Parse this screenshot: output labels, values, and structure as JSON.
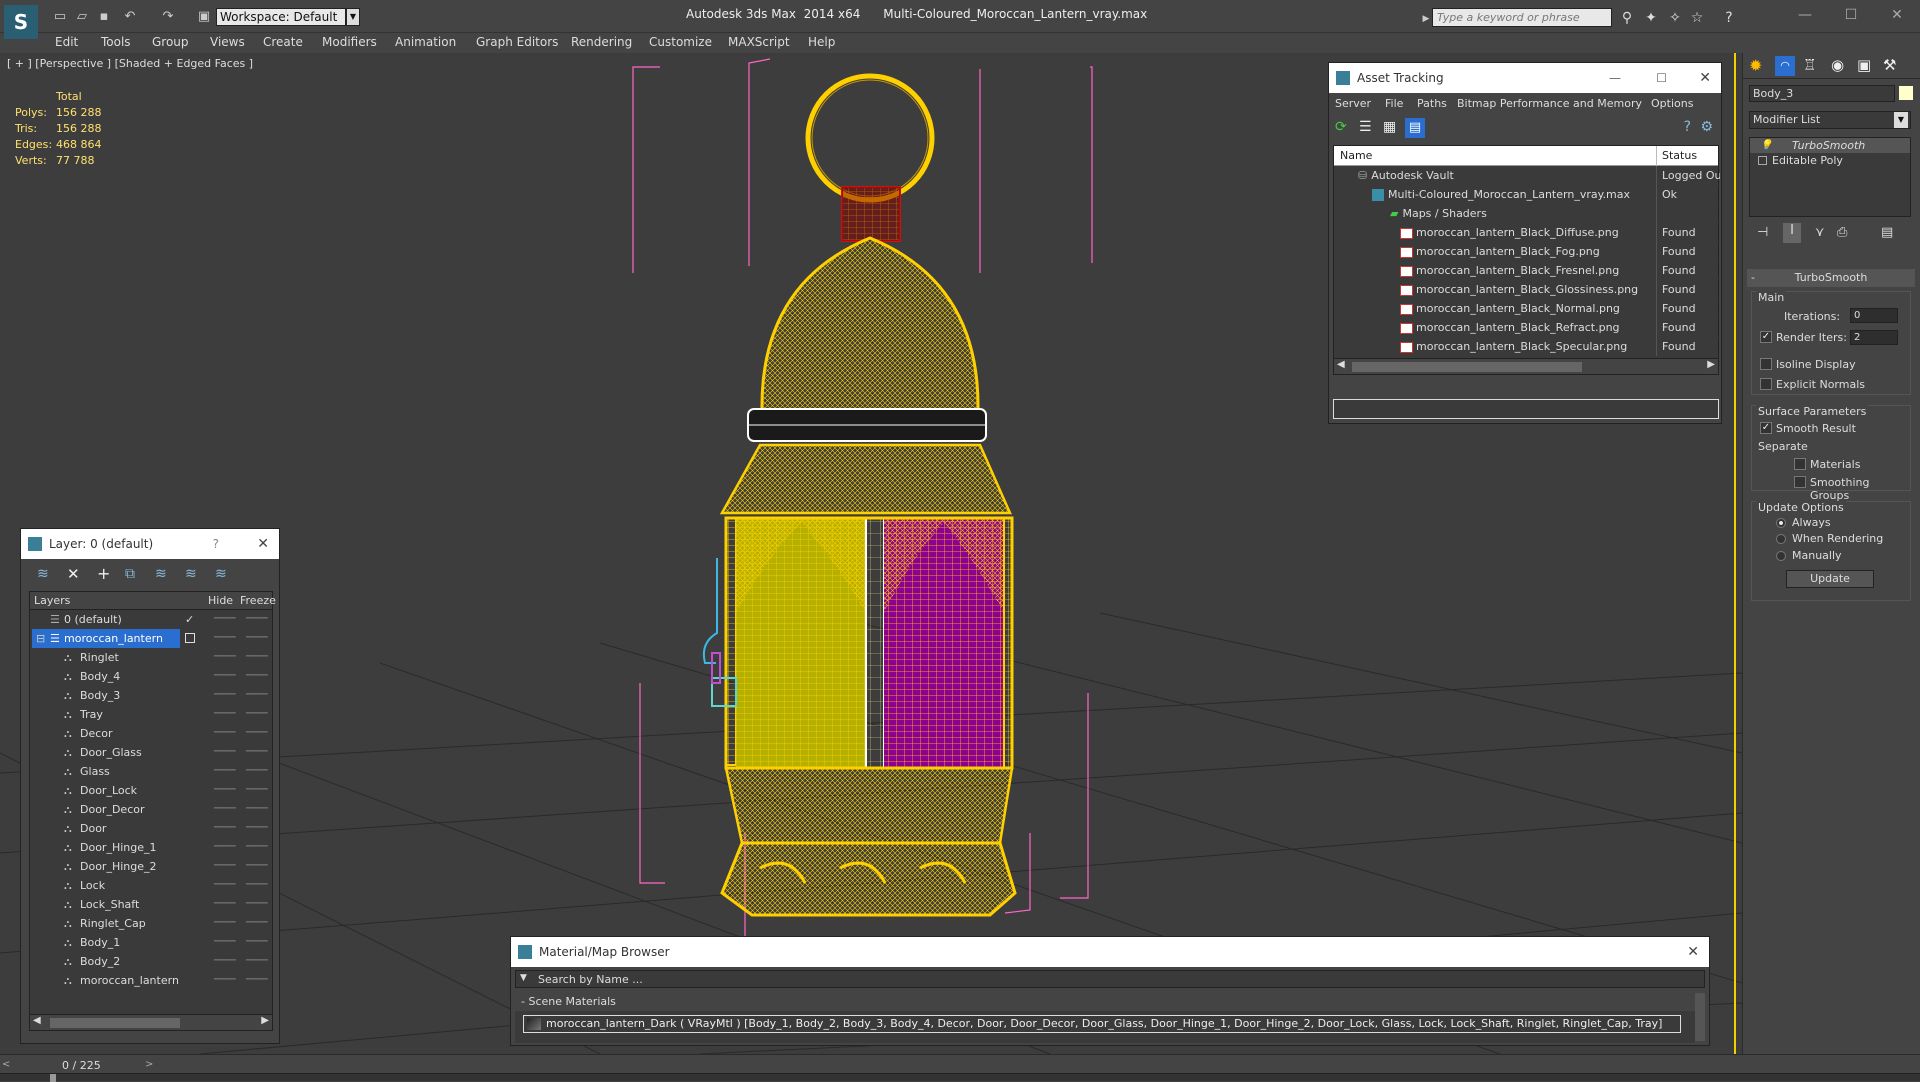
{
  "titlebar": {
    "workspace": "Workspace: Default",
    "title": "Autodesk 3ds Max  2014 x64      Multi-Coloured_Moroccan_Lantern_vray.max",
    "search_placeholder": "Type a keyword or phrase"
  },
  "menu": [
    "Edit",
    "Tools",
    "Group",
    "Views",
    "Create",
    "Modifiers",
    "Animation",
    "Graph Editors",
    "Rendering",
    "Customize",
    "MAXScript",
    "Help"
  ],
  "viewport": {
    "label": "[ + ] [Perspective ] [Shaded + Edged Faces ]",
    "stats_header": "Total",
    "stats": [
      {
        "k": "Polys:",
        "v": "156 288"
      },
      {
        "k": "Tris:",
        "v": "156 288"
      },
      {
        "k": "Edges:",
        "v": "468 864"
      },
      {
        "k": "Verts:",
        "v": "77 788"
      }
    ]
  },
  "layer_panel": {
    "title": "Layer: 0 (default)",
    "help": "?",
    "col_layers": "Layers",
    "col_hide": "Hide",
    "col_freeze": "Freeze",
    "default_layer": "0 (default)",
    "selected_layer": "moroccan_lantern",
    "objects": [
      "Ringlet",
      "Body_4",
      "Body_3",
      "Tray",
      "Decor",
      "Door_Glass",
      "Glass",
      "Door_Lock",
      "Door_Decor",
      "Door",
      "Door_Hinge_1",
      "Door_Hinge_2",
      "Lock",
      "Lock_Shaft",
      "Ringlet_Cap",
      "Body_1",
      "Body_2",
      "moroccan_lantern"
    ]
  },
  "asset_tracking": {
    "title": "Asset Tracking",
    "menu": [
      "Server",
      "File",
      "Paths",
      "Bitmap Performance and Memory",
      "Options"
    ],
    "col_name": "Name",
    "col_status": "Status",
    "rows": [
      {
        "name": "Autodesk Vault",
        "status": "Logged Ou",
        "level": 1,
        "type": "vault"
      },
      {
        "name": "Multi-Coloured_Moroccan_Lantern_vray.max",
        "status": "Ok",
        "level": 2,
        "type": "max"
      },
      {
        "name": "Maps / Shaders",
        "status": "",
        "level": 3,
        "type": "maps"
      },
      {
        "name": "moroccan_lantern_Black_Diffuse.png",
        "status": "Found",
        "level": 4,
        "type": "png"
      },
      {
        "name": "moroccan_lantern_Black_Fog.png",
        "status": "Found",
        "level": 4,
        "type": "png"
      },
      {
        "name": "moroccan_lantern_Black_Fresnel.png",
        "status": "Found",
        "level": 4,
        "type": "png"
      },
      {
        "name": "moroccan_lantern_Black_Glossiness.png",
        "status": "Found",
        "level": 4,
        "type": "png"
      },
      {
        "name": "moroccan_lantern_Black_Normal.png",
        "status": "Found",
        "level": 4,
        "type": "png"
      },
      {
        "name": "moroccan_lantern_Black_Refract.png",
        "status": "Found",
        "level": 4,
        "type": "png"
      },
      {
        "name": "moroccan_lantern_Black_Specular.png",
        "status": "Found",
        "level": 4,
        "type": "png"
      }
    ]
  },
  "material_browser": {
    "title": "Material/Map Browser",
    "search_placeholder": "Search by Name ...",
    "group": "- Scene Materials",
    "material": "moroccan_lantern_Dark  ( VRayMtl ) [Body_1, Body_2, Body_3, Body_4, Decor, Door, Door_Decor, Door_Glass, Door_Hinge_1, Door_Hinge_2, Door_Lock, Glass, Lock, Lock_Shaft, Ringlet, Ringlet_Cap, Tray]"
  },
  "command_panel": {
    "object_name": "Body_3",
    "modifier_list": "Modifier List",
    "stack": [
      "TurboSmooth",
      "Editable Poly"
    ],
    "rollout_title": "TurboSmooth",
    "main_group": "Main",
    "iterations_label": "Iterations:",
    "iterations_value": "0",
    "render_iters_label": "Render Iters:",
    "render_iters_value": "2",
    "isoline": "Isoline Display",
    "explicit_normals": "Explicit Normals",
    "surface_group": "Surface Parameters",
    "smooth_result": "Smooth Result",
    "separate": "Separate",
    "materials": "Materials",
    "smoothing_groups": "Smoothing Groups",
    "update_group": "Update Options",
    "always": "Always",
    "when_rendering": "When Rendering",
    "manually": "Manually",
    "update_button": "Update"
  },
  "timeline": {
    "frame": "0 / 225"
  },
  "colors": {
    "wire": "#ffd000",
    "glass_yellow": "#b5b000",
    "glass_magenta": "#8e0090",
    "selection": "#2a6ed0",
    "helper": "#ff66c8"
  }
}
